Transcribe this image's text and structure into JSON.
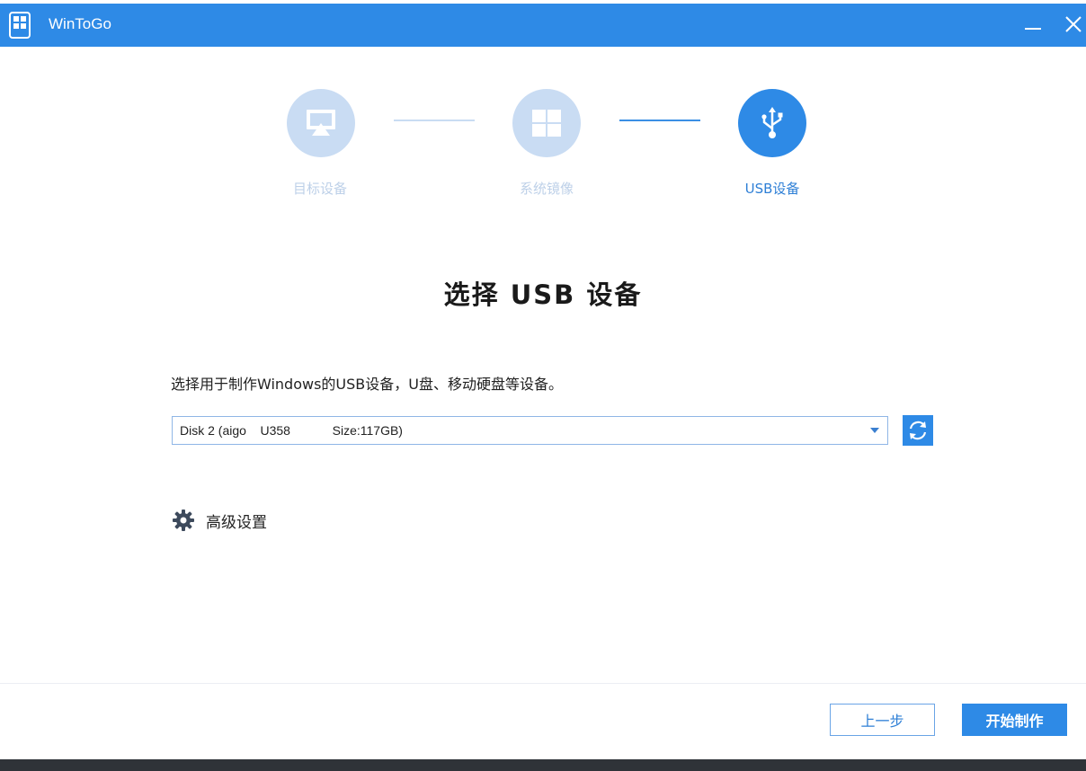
{
  "window": {
    "title": "WinToGo"
  },
  "colors": {
    "accent": "#2e8ae6",
    "inactive_step": "#c9dcf3"
  },
  "steps": [
    {
      "label": "目标设备",
      "icon": "display-icon",
      "state": "inactive"
    },
    {
      "label": "系统镜像",
      "icon": "windows-icon",
      "state": "inactive"
    },
    {
      "label": "USB设备",
      "icon": "usb-icon",
      "state": "active"
    }
  ],
  "main": {
    "heading": "选择 USB 设备",
    "instruction": "选择用于制作Windows的USB设备，U盘、移动硬盘等设备。",
    "device_select": {
      "value": "Disk 2 (aigo    U358            Size:117GB)"
    },
    "advanced_label": "高级设置"
  },
  "footer": {
    "prev_label": "上一步",
    "start_label": "开始制作"
  }
}
